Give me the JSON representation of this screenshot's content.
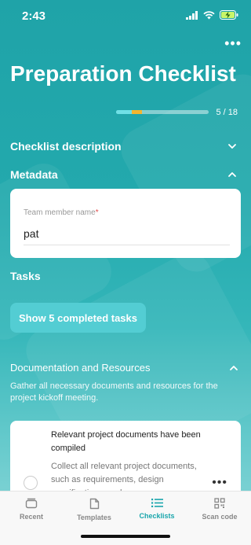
{
  "status_bar": {
    "time": "2:43"
  },
  "header": {
    "title": "Preparation Checklist"
  },
  "progress": {
    "label": "5 / 18",
    "completed": 5,
    "total": 18
  },
  "sections": {
    "description": "Checklist description",
    "metadata": "Metadata",
    "tasks": "Tasks"
  },
  "metadata_form": {
    "field_label": "Team member name",
    "required_mark": "*",
    "field_value": "pat"
  },
  "show_completed_button": "Show 5 completed tasks",
  "task_group": {
    "title": "Documentation and Resources",
    "description": "Gather all necessary documents and resources for the project kickoff meeting."
  },
  "task": {
    "title": "Relevant project documents have been compiled",
    "description": "Collect all relevant project documents, such as requirements, design specifications, and"
  },
  "tabs": [
    {
      "label": "Recent",
      "icon": "recent-icon"
    },
    {
      "label": "Templates",
      "icon": "templates-icon"
    },
    {
      "label": "Checklists",
      "icon": "checklists-icon"
    },
    {
      "label": "Scan code",
      "icon": "qr-code-icon"
    }
  ],
  "colors": {
    "accent": "#1aa6ac",
    "progress_highlight": "#f5b52e",
    "button": "#53cdd3"
  }
}
